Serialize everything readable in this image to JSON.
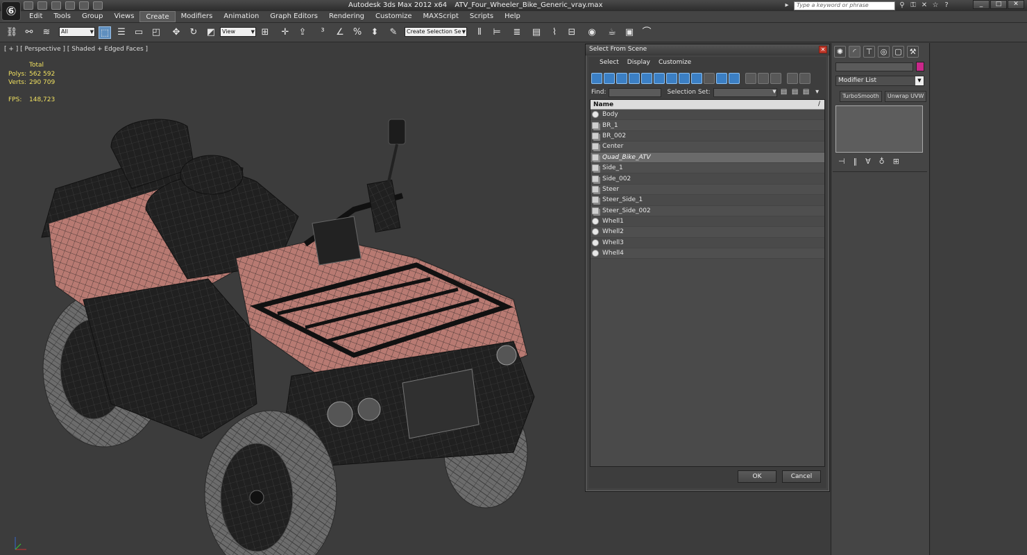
{
  "window": {
    "app_name": "Autodesk 3ds Max  2012 x64",
    "file_name": "ATV_Four_Wheeler_Bike_Generic_vray.max",
    "search_placeholder": "Type a keyword or phrase"
  },
  "menu": [
    "Edit",
    "Tools",
    "Group",
    "Views",
    "Create",
    "Modifiers",
    "Animation",
    "Graph Editors",
    "Rendering",
    "Customize",
    "MAXScript",
    "Scripts",
    "Help"
  ],
  "toolbar": {
    "selection_filter": "All",
    "coord_system": "View",
    "named_selection_placeholder": "Create Selection Se"
  },
  "viewport": {
    "label": "[ + ] [ Perspective ] [ Shaded + Edged Faces ]",
    "stats": {
      "header": "Total",
      "polys_label": "Polys:",
      "polys_value": "562 592",
      "verts_label": "Verts:",
      "verts_value": "290 709",
      "fps_label": "FPS:",
      "fps_value": "148,723"
    }
  },
  "dialog": {
    "title": "Select From Scene",
    "menu": [
      "Select",
      "Display",
      "Customize"
    ],
    "find_label": "Find:",
    "selection_set_label": "Selection Set:",
    "column_header": "Name",
    "items": [
      {
        "name": "Body",
        "icon": "object-sphere-icon",
        "selected": false
      },
      {
        "name": "BR_1",
        "icon": "group-icon",
        "selected": false
      },
      {
        "name": "BR_002",
        "icon": "group-icon",
        "selected": false
      },
      {
        "name": "Center",
        "icon": "group-icon",
        "selected": false
      },
      {
        "name": "Quad_Bike_ATV",
        "icon": "group-icon",
        "selected": true
      },
      {
        "name": "Side_1",
        "icon": "group-icon",
        "selected": false
      },
      {
        "name": "Side_002",
        "icon": "group-icon",
        "selected": false
      },
      {
        "name": "Steer",
        "icon": "group-icon",
        "selected": false
      },
      {
        "name": "Steer_Side_1",
        "icon": "group-icon",
        "selected": false
      },
      {
        "name": "Steer_Side_002",
        "icon": "group-icon",
        "selected": false
      },
      {
        "name": "Whell1",
        "icon": "object-sphere-icon",
        "selected": false
      },
      {
        "name": "Whell2",
        "icon": "object-sphere-icon",
        "selected": false
      },
      {
        "name": "Whell3",
        "icon": "object-sphere-icon",
        "selected": false
      },
      {
        "name": "Whell4",
        "icon": "object-sphere-icon",
        "selected": false
      }
    ],
    "ok_label": "OK",
    "cancel_label": "Cancel"
  },
  "command_panel": {
    "modifier_list_label": "Modifier List",
    "modifier_buttons": [
      "TurboSmooth",
      "Unwrap UVW"
    ],
    "object_color": "#c9288a"
  },
  "colors": {
    "accent_blue": "#3b7fc4",
    "stats_yellow": "#f0e060",
    "body_pink": "#b87a72"
  }
}
